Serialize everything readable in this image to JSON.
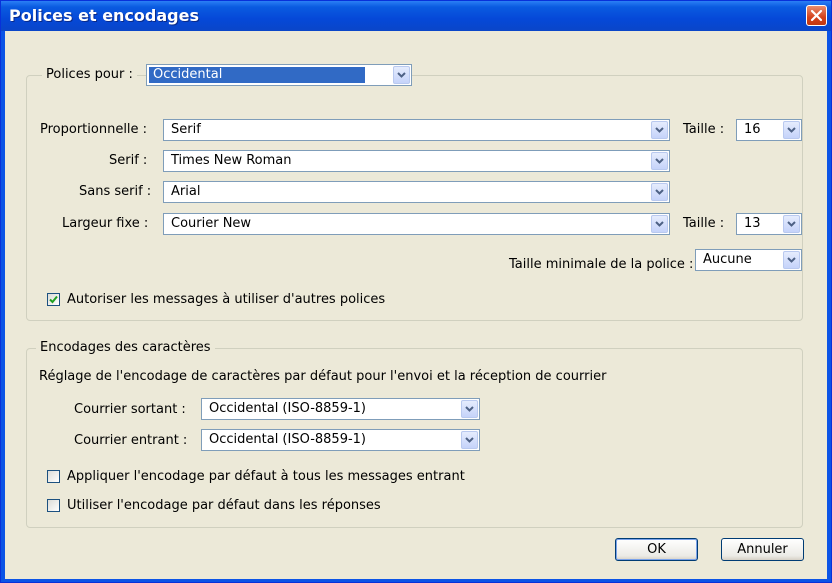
{
  "window": {
    "title": "Polices et encodages"
  },
  "fonts_group": {
    "legend": "Polices pour :",
    "language": "Occidental",
    "rows": [
      {
        "label": "Proportionnelle :",
        "value": "Serif"
      },
      {
        "label": "Serif :",
        "value": "Times New Roman"
      },
      {
        "label": "Sans serif :",
        "value": "Arial"
      },
      {
        "label": "Largeur fixe :",
        "value": "Courier New"
      }
    ],
    "size_label_1": "Taille :",
    "size_value_1": "16",
    "size_label_2": "Taille :",
    "size_value_2": "13",
    "min_size_label": "Taille minimale de la police :",
    "min_size_value": "Aucune",
    "allow_fonts_label": "Autoriser les messages à utiliser d'autres polices",
    "allow_fonts_checked": true
  },
  "encoding_group": {
    "legend": "Encodages des caractères",
    "description": "Réglage de l'encodage de caractères par défaut pour l'envoi et la réception de courrier",
    "outgoing_label": "Courrier sortant :",
    "outgoing_value": "Occidental (ISO-8859-1)",
    "incoming_label": "Courrier entrant :",
    "incoming_value": "Occidental (ISO-8859-1)",
    "apply_all_label": "Appliquer l'encodage par défaut à tous les messages entrant",
    "apply_all_checked": false,
    "use_in_replies_label": "Utiliser l'encodage par défaut dans les réponses",
    "use_in_replies_checked": false
  },
  "buttons": {
    "ok": "OK",
    "cancel": "Annuler"
  },
  "icons": {
    "close": "close-icon",
    "dropdown": "chevron-down-icon",
    "check": "check-icon"
  },
  "colors": {
    "titlebar": "#0548d8",
    "dialog_bg": "#ece9d8",
    "selection": "#316ac5",
    "close_button": "#d4421c"
  }
}
